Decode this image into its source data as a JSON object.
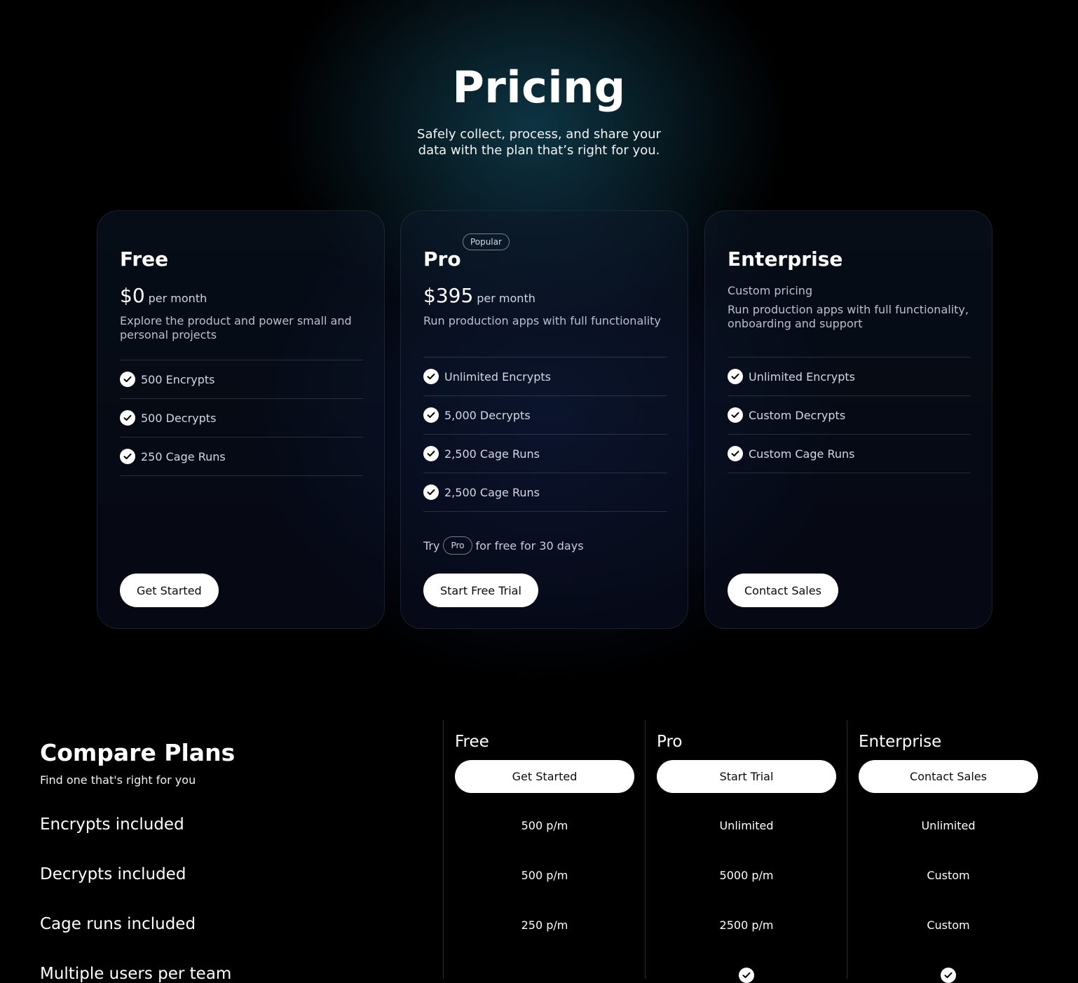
{
  "hero": {
    "title": "Pricing",
    "subtitle_line1": "Safely collect, process, and share your",
    "subtitle_line2": "data with the plan that’s right for you."
  },
  "plans": [
    {
      "name": "Free",
      "price": "$0",
      "period": "per month",
      "description": "Explore the product and power small and personal projects",
      "features": [
        "500 Encrypts",
        "500 Decrypts",
        "250 Cage Runs"
      ],
      "cta": "Get Started"
    },
    {
      "name": "Pro",
      "badge": "Popular",
      "price": "$395",
      "period": "per month",
      "description": "Run production apps with full functionality",
      "features": [
        "Unlimited Encrypts",
        "5,000 Decrypts",
        "2,500 Cage Runs",
        "2,500 Cage Runs"
      ],
      "trial": {
        "prefix": "Try",
        "pill": "Pro",
        "suffix": "for free for 30 days"
      },
      "cta": "Start Free Trial"
    },
    {
      "name": "Enterprise",
      "custom_pricing": "Custom pricing",
      "description": "Run production apps with full functionality, onboarding and support",
      "features": [
        "Unlimited Encrypts",
        "Custom Decrypts",
        "Custom Cage Runs"
      ],
      "cta": "Contact Sales"
    }
  ],
  "compare": {
    "title": "Compare Plans",
    "subtitle": "Find one that's right for you",
    "columns": [
      {
        "name": "Free",
        "cta": "Get Started"
      },
      {
        "name": "Pro",
        "cta": "Start Trial"
      },
      {
        "name": "Enterprise",
        "cta": "Contact Sales"
      }
    ],
    "rows": [
      {
        "label": "Encrypts included",
        "values": [
          "500 p/m",
          "Unlimited",
          "Unlimited"
        ]
      },
      {
        "label": "Decrypts included",
        "values": [
          "500 p/m",
          "5000 p/m",
          "Custom"
        ]
      },
      {
        "label": "Cage runs included",
        "values": [
          "250 p/m",
          "2500 p/m",
          "Custom"
        ]
      },
      {
        "label": "Multiple users per team",
        "values": [
          "",
          "check",
          "check"
        ]
      }
    ]
  },
  "icons": {
    "feature": "check-circle-icon"
  },
  "colors": {
    "background": "#000000",
    "button": "#ffffff",
    "button_text": "#0a0a0a"
  }
}
